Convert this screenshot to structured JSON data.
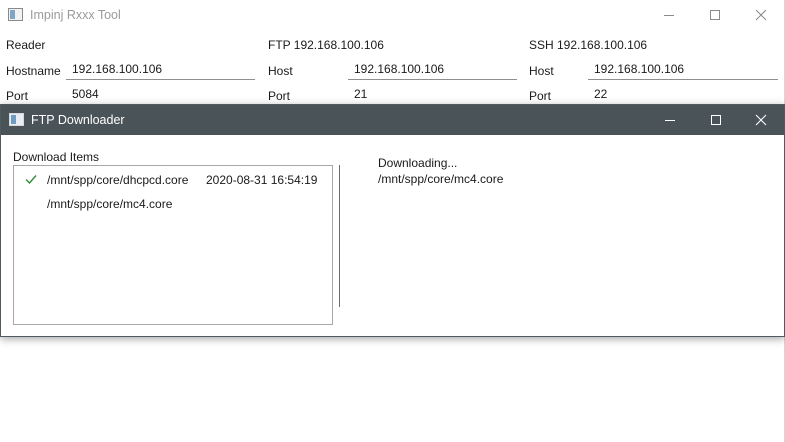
{
  "main_window": {
    "title": "Impinj Rxxx Tool",
    "reader": {
      "heading": "Reader",
      "hostname_label": "Hostname",
      "hostname_value": "192.168.100.106",
      "port_label": "Port",
      "port_value": "5084"
    },
    "ftp": {
      "heading": "FTP 192.168.100.106",
      "host_label": "Host",
      "host_value": "192.168.100.106",
      "port_label": "Port",
      "port_value": "21"
    },
    "ssh": {
      "heading": "SSH 192.168.100.106",
      "host_label": "Host",
      "host_value": "192.168.100.106",
      "port_label": "Port",
      "port_value": "22"
    }
  },
  "dialog": {
    "title": "FTP Downloader",
    "download_items_label": "Download Items",
    "items": [
      {
        "path": "/mnt/spp/core/dhcpcd.core",
        "timestamp": "2020-08-31 16:54:19",
        "done": true
      },
      {
        "path": "/mnt/spp/core/mc4.core",
        "timestamp": "",
        "done": false
      }
    ],
    "status_title": "Downloading...",
    "status_file": "/mnt/spp/core/mc4.core"
  },
  "colors": {
    "dialog_titlebar": "#4a5358",
    "check_green": "#2e8b3a",
    "disabled_title": "#9a9a9a"
  },
  "icons": {
    "app": "app-window-icon",
    "minimize": "minimize-icon",
    "maximize": "maximize-icon",
    "close": "close-icon",
    "done": "checkmark-icon"
  }
}
